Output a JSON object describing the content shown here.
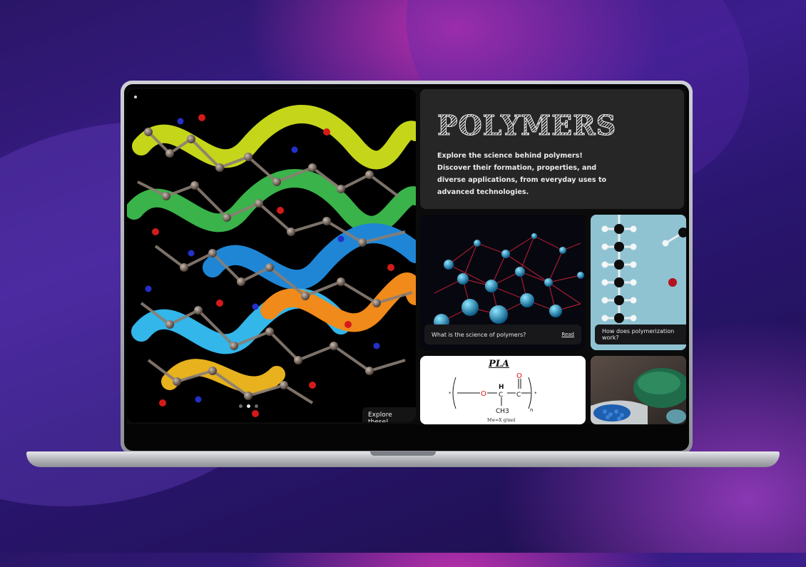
{
  "hero": {
    "carousel_dots": 3,
    "active_dot": 1,
    "explore_label": "Explore these!"
  },
  "intro": {
    "title": "POLYMERS",
    "description": "Explore the science behind polymers! Discover their formation, properties, and diverse applications, from everyday uses to advanced technologies."
  },
  "cards": [
    {
      "caption": "What is the science of polymers?",
      "link": "Read"
    },
    {
      "caption": "How does polymerization work?"
    }
  ],
  "pla": {
    "title": "PLA",
    "o_left": "O",
    "h": "H",
    "c1": "C",
    "c2": "C",
    "o_top": "O",
    "ch3": "CH3",
    "n": "n",
    "star_left": "*",
    "star_right": "*",
    "mw": "Mw=X g/mol"
  }
}
